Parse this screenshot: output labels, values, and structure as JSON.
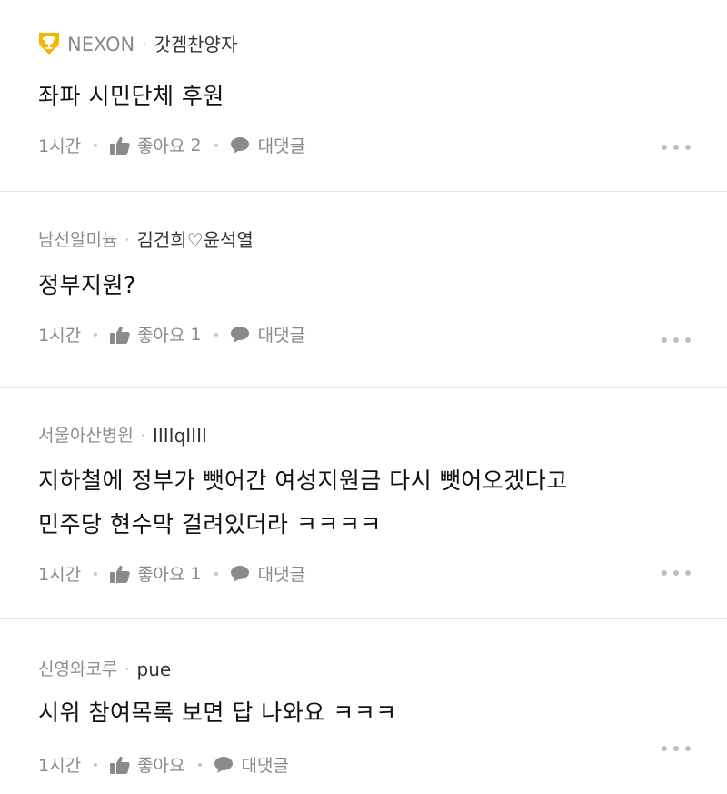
{
  "comments": [
    {
      "guild": "NEXON",
      "has_trophy": true,
      "nickname": "갓겜찬양자",
      "body_lines": [
        "좌파 시민단체 후원"
      ],
      "time": "1시간",
      "like_label": "좋아요",
      "like_count": "2",
      "reply_label": "대댓글"
    },
    {
      "guild": "남선알미늄",
      "has_trophy": false,
      "nickname": "김건희♡윤석열",
      "body_lines": [
        "정부지원?"
      ],
      "time": "1시간",
      "like_label": "좋아요",
      "like_count": "1",
      "reply_label": "대댓글"
    },
    {
      "guild": "서울아산병원",
      "has_trophy": false,
      "nickname": "IIIIqIIII",
      "body_lines": [
        "지하철에 정부가 뺏어간 여성지원금 다시 뺏어오겠다고",
        "민주당 현수막 걸려있더라 ㅋㅋㅋㅋ"
      ],
      "time": "1시간",
      "like_label": "좋아요",
      "like_count": "1",
      "reply_label": "대댓글"
    },
    {
      "guild": "신영와코루",
      "has_trophy": false,
      "nickname": "pue",
      "body_lines": [
        "시위 참여목록 보면 답 나와요 ㅋㅋㅋ"
      ],
      "time": "1시간",
      "like_label": "좋아요",
      "like_count": "",
      "reply_label": "대댓글"
    }
  ],
  "separator": "·",
  "icons": {
    "trophy": "trophy-icon",
    "like": "thumbs-up-icon",
    "reply": "speech-bubble-icon",
    "more": "more-dots-icon"
  },
  "colors": {
    "trophy": "#f5b700",
    "meta_gray": "#8a8a8a",
    "divider": "#e4e4e4"
  }
}
